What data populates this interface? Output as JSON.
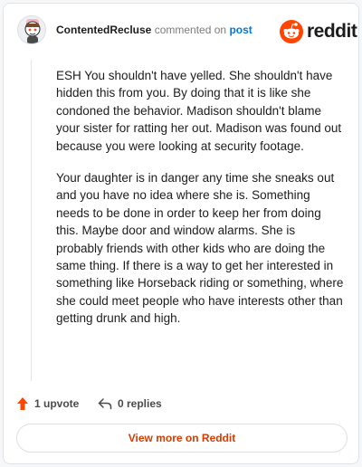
{
  "header": {
    "username": "ContentedRecluse",
    "action_text": "commented on",
    "post_link": "post",
    "brand": "reddit",
    "avatar_icon": "snoo-avatar-icon",
    "brand_icon": "reddit-logo-icon",
    "brand_color": "#ff4500"
  },
  "comment": {
    "paragraphs": [
      "ESH You shouldn't have yelled. She shouldn't have hidden this from you. By doing that it is like she condoned the behavior. Madison shouldn't blame your sister for ratting her out. Madison was found out because you were looking at security footage.",
      "Your daughter is in danger any time she sneaks out and you have no idea where she is. Something needs to be done in order to keep her from doing this. Maybe door and window alarms. She is probably friends with other kids who are doing the same thing. If there is a way to get her interested in something like Horseback riding or something, where she could meet people who have interests other than getting drunk and high."
    ]
  },
  "actions": {
    "upvote_label": "1 upvote",
    "upvote_icon": "upvote-arrow-icon",
    "replies_label": "0 replies",
    "replies_icon": "reply-arrow-icon"
  },
  "footer": {
    "view_more_label": "View more on Reddit"
  }
}
